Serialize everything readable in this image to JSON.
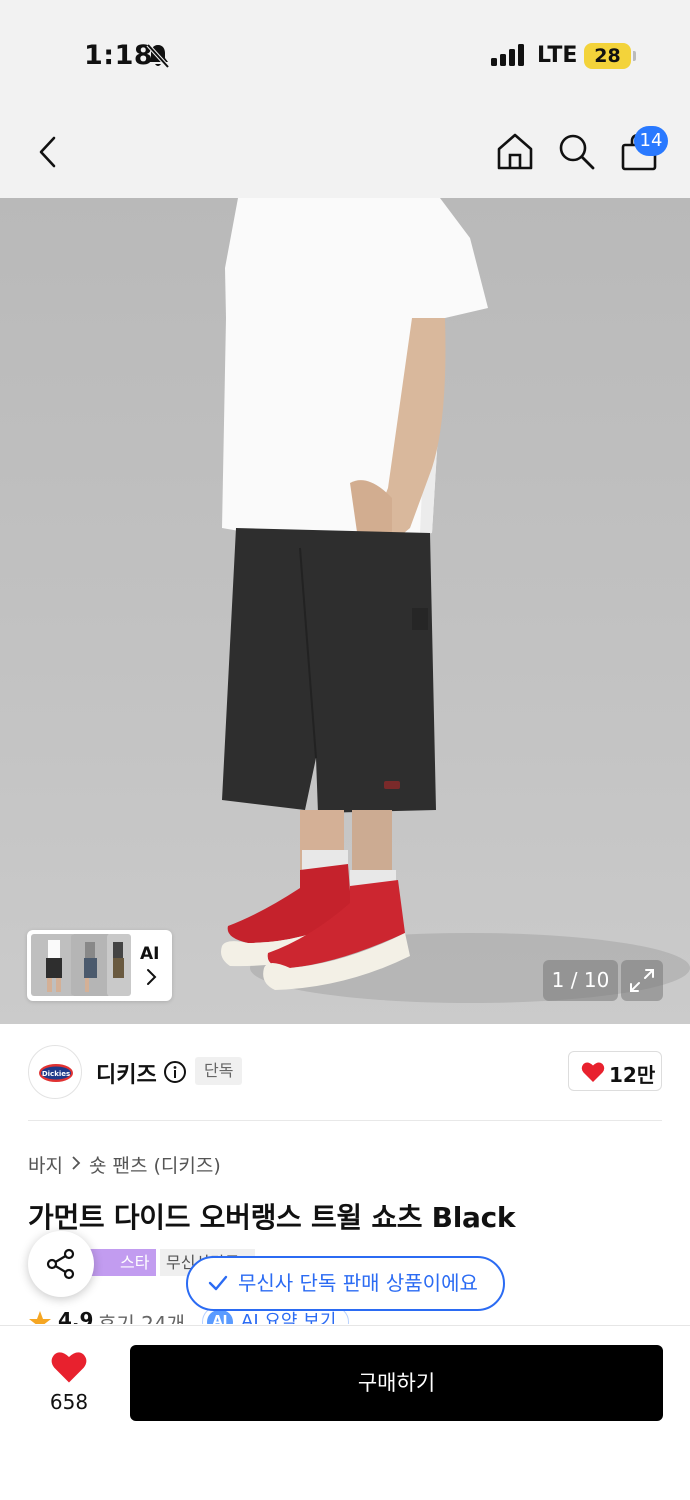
{
  "status_bar": {
    "time": "1:18",
    "network": "LTE",
    "battery": "28",
    "icons": [
      "bell-slash-icon",
      "signal-icon"
    ]
  },
  "header": {
    "icons": [
      "back-icon",
      "home-icon",
      "search-icon",
      "cart-icon"
    ],
    "cart_count": "14"
  },
  "gallery": {
    "counter": "1 / 10",
    "ai_label": "AI",
    "icons": [
      "expand-icon",
      "chevron-right-icon"
    ]
  },
  "brand": {
    "name": "디키즈",
    "tag": "단독",
    "like_count": "12만",
    "icons": [
      "info-icon",
      "heart-icon"
    ]
  },
  "breadcrumb": {
    "items": [
      "바지",
      "숏 팬츠 (디키즈)"
    ]
  },
  "product": {
    "title": "가먼트 다이드 오버랭스 트윌 쇼츠 Black",
    "badges": [
      "스타",
      "무신사단독"
    ],
    "rating": "4.9",
    "review_text": "후기 24개",
    "ai_summary_badge": "AI",
    "ai_summary": "AI 요약 보기"
  },
  "toast": {
    "message": "무신사 단독 판매 상품이에요"
  },
  "bottom_bar": {
    "favorite_count": "658",
    "buy_label": "구매하기"
  },
  "colors": {
    "accent_blue": "#2b6bf3",
    "badge_blue": "#2979ff",
    "heart_red": "#e8212e",
    "badge_purple": "#c29cf0",
    "battery_yellow": "#f3d33a"
  }
}
